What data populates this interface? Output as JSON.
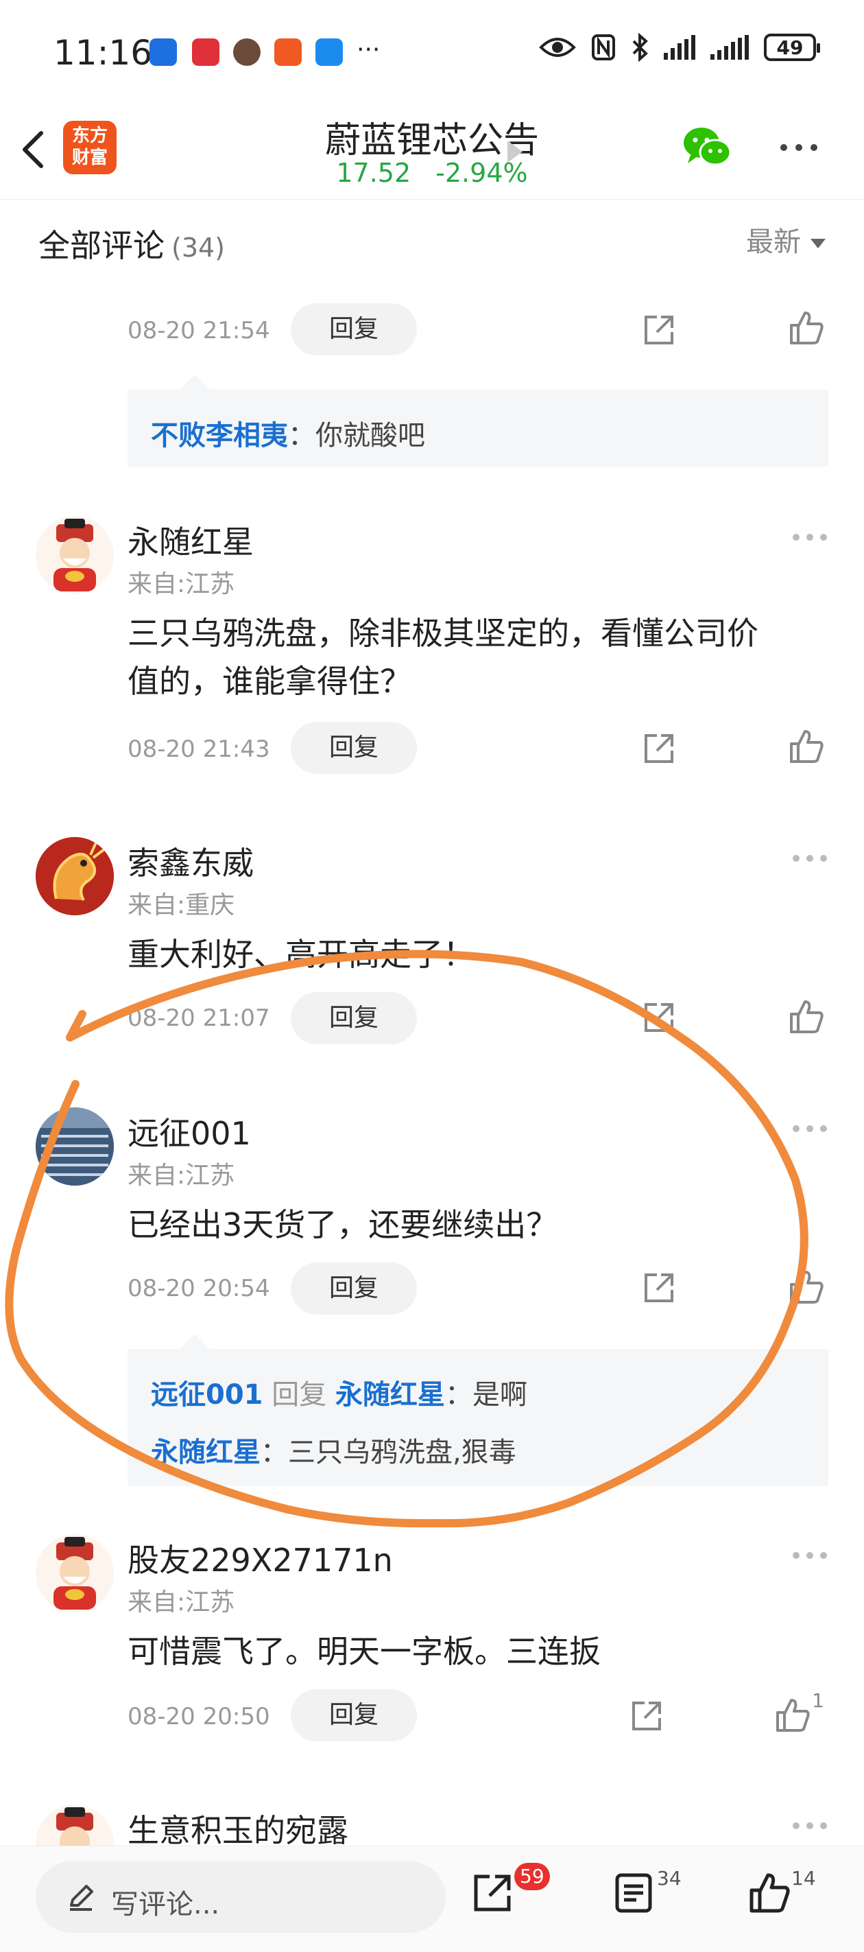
{
  "status_bar": {
    "time": "11:16",
    "battery": "49"
  },
  "header": {
    "logo_text_line1": "东方",
    "logo_text_line2": "财富",
    "title": "蔚蓝锂芯公告",
    "price": "17.52",
    "change": "-2.94%"
  },
  "section": {
    "title": "全部评论",
    "count": "(34)",
    "sort": "最新"
  },
  "comments": [
    {
      "date": "08-20 21:54",
      "reply_label": "回复",
      "replies": [
        {
          "user": "不败李相夷",
          "sep": "：",
          "text": "你就酸吧"
        }
      ]
    },
    {
      "user": "永随红星",
      "location": "来自:江苏",
      "text_line1": "三只乌鸦洗盘，除非极其坚定的，看懂公司价",
      "text_line2": "值的，谁能拿得住？",
      "date": "08-20 21:43",
      "reply_label": "回复"
    },
    {
      "user": "索鑫东威",
      "location": "来自:重庆",
      "text": "重大利好、高开高走了！",
      "date": "08-20 21:07",
      "reply_label": "回复"
    },
    {
      "user": "远征001",
      "location": "来自:江苏",
      "text": "已经出3天货了，还要继续出？",
      "date": "08-20 20:54",
      "reply_label": "回复",
      "replies": [
        {
          "user": "远征001",
          "verb": "回复",
          "target": "永随红星",
          "sep": "：",
          "text": "是啊"
        },
        {
          "user": "永随红星",
          "sep": "：",
          "text": "三只乌鸦洗盘,狠毒"
        }
      ]
    },
    {
      "user": "股友229X27171n",
      "location": "来自:江苏",
      "text": "可惜震飞了。明天一字板。三连扳",
      "date": "08-20 20:50",
      "reply_label": "回复",
      "likes": "1"
    },
    {
      "user": "生意积玉的宛露"
    }
  ],
  "bottom_bar": {
    "placeholder": "写评论...",
    "share_badge": "59",
    "comments_count": "34",
    "likes_count": "14"
  },
  "colors": {
    "price_green": "#27a744",
    "link_blue": "#1a6fd1",
    "brand_orange": "#f0541d",
    "annotation": "#f08a3c"
  }
}
